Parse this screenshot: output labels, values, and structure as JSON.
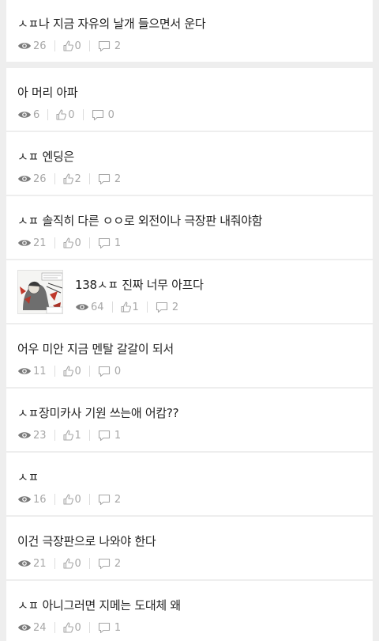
{
  "posts": [
    {
      "title": "ㅅㅍ나 지금 자유의 날개 들으면서 운다",
      "views": "26",
      "likes": "0",
      "comments": "2"
    },
    {
      "title": "아 머리 아파",
      "views": "6",
      "likes": "0",
      "comments": "0"
    },
    {
      "title": "ㅅㅍ 엔딩은",
      "views": "26",
      "likes": "2",
      "comments": "2"
    },
    {
      "title": "ㅅㅍ 솔직히 다른 ㅇㅇ로 외전이나 극장판 내줘야함",
      "views": "21",
      "likes": "0",
      "comments": "1"
    },
    {
      "title": "138ㅅㅍ 진짜 너무 아프다",
      "views": "64",
      "likes": "1",
      "comments": "2"
    },
    {
      "title": "어우 미안 지금 멘탈 갈갈이 되서",
      "views": "11",
      "likes": "0",
      "comments": "0"
    },
    {
      "title": "ㅅㅍ장미카사 기원 쓰는애 어캄??",
      "views": "23",
      "likes": "1",
      "comments": "1"
    },
    {
      "title": "ㅅㅍ",
      "views": "16",
      "likes": "0",
      "comments": "2"
    },
    {
      "title": "이건 극장판으로 나와야 한다",
      "views": "21",
      "likes": "0",
      "comments": "2"
    },
    {
      "title": "ㅅㅍ 아니그러면 지메는 도대체 왜",
      "views": "24",
      "likes": "0",
      "comments": "1"
    }
  ],
  "icons": {
    "views": "eye-icon",
    "likes": "thumbs-up-icon",
    "comments": "comment-icon",
    "thumbnail": "post-thumbnail-image"
  },
  "colors": {
    "background": "#eeeeee",
    "card": "#ffffff",
    "title": "#1f1f1f",
    "meta": "#a7a7a7",
    "eye": "#7a7a7a"
  }
}
